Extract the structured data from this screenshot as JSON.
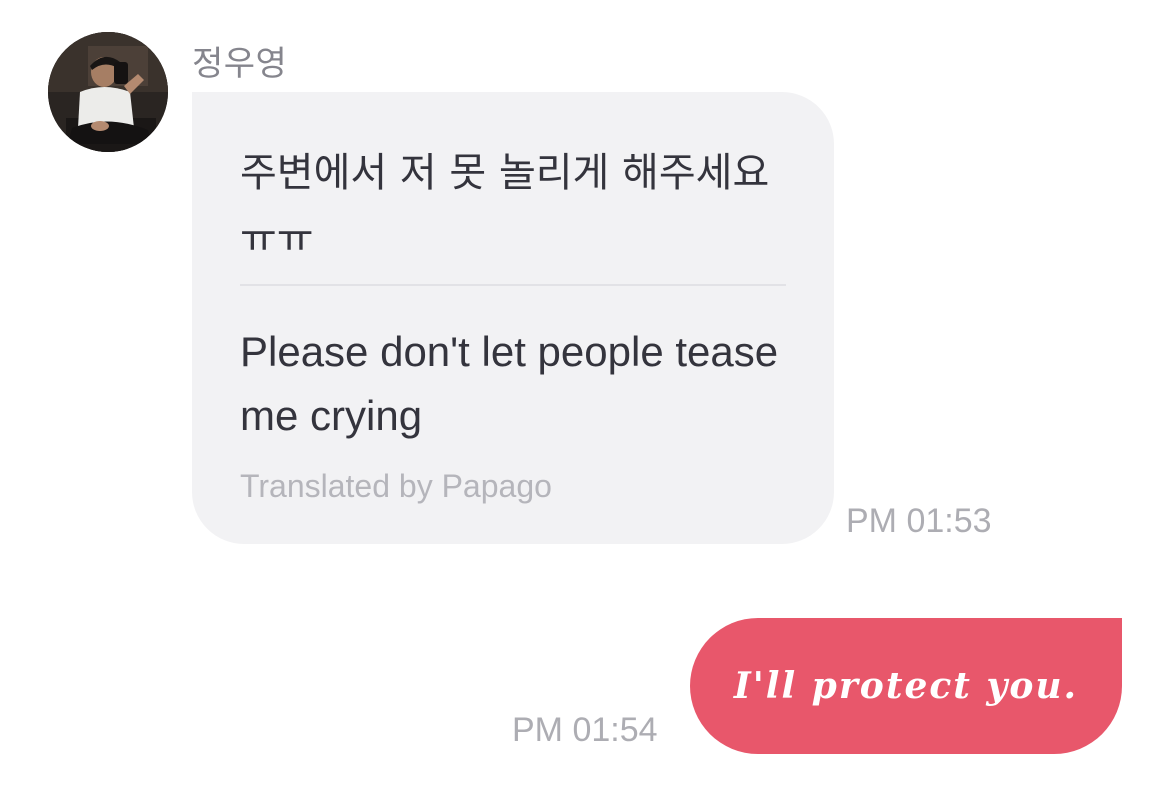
{
  "incoming": {
    "sender": "정우영",
    "original": "주변에서 저 못 놀리게 해주세요 ㅠㅠ",
    "translation": "Please don't let people tease me crying",
    "translator": "Translated by Papago",
    "time": "PM 01:53",
    "avatar_icon": "profile-photo"
  },
  "outgoing": {
    "text": "I'll protect you.",
    "time": "PM 01:54"
  },
  "colors": {
    "incoming_bubble": "#f2f2f4",
    "outgoing_bubble": "#e8576b",
    "muted_text": "#adadb3"
  }
}
